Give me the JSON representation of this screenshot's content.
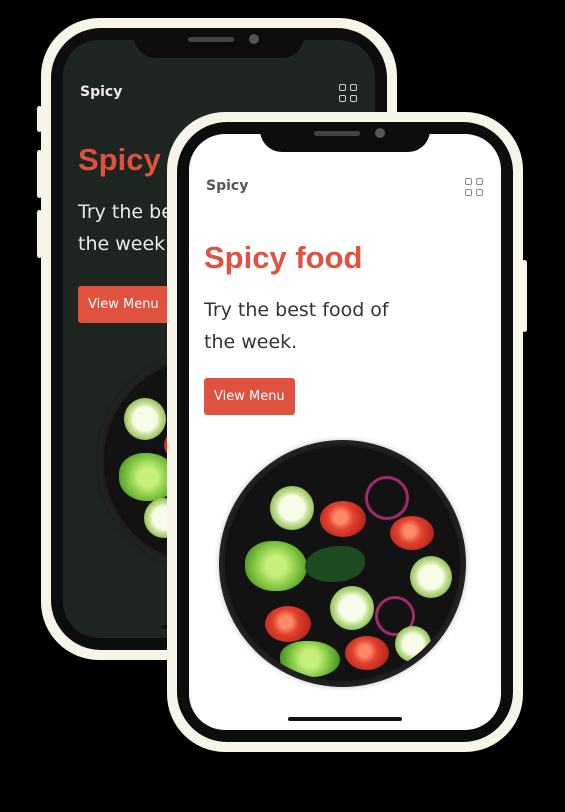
{
  "back_screen": {
    "brand": "Spicy",
    "title": "Spicy food",
    "subtitle": "Try the best food of the week.",
    "cta_label": "View Menu",
    "menu_icon": "grid-icon",
    "background": "#1f2520"
  },
  "front_screen": {
    "brand": "Spicy",
    "title": "Spicy food",
    "subtitle": "Try the best food of the week.",
    "cta_label": "View Menu",
    "menu_icon": "grid-icon",
    "background": "#ffffff"
  },
  "colors": {
    "accent": "#e0523f",
    "device_frame": "#f7f4ea"
  }
}
